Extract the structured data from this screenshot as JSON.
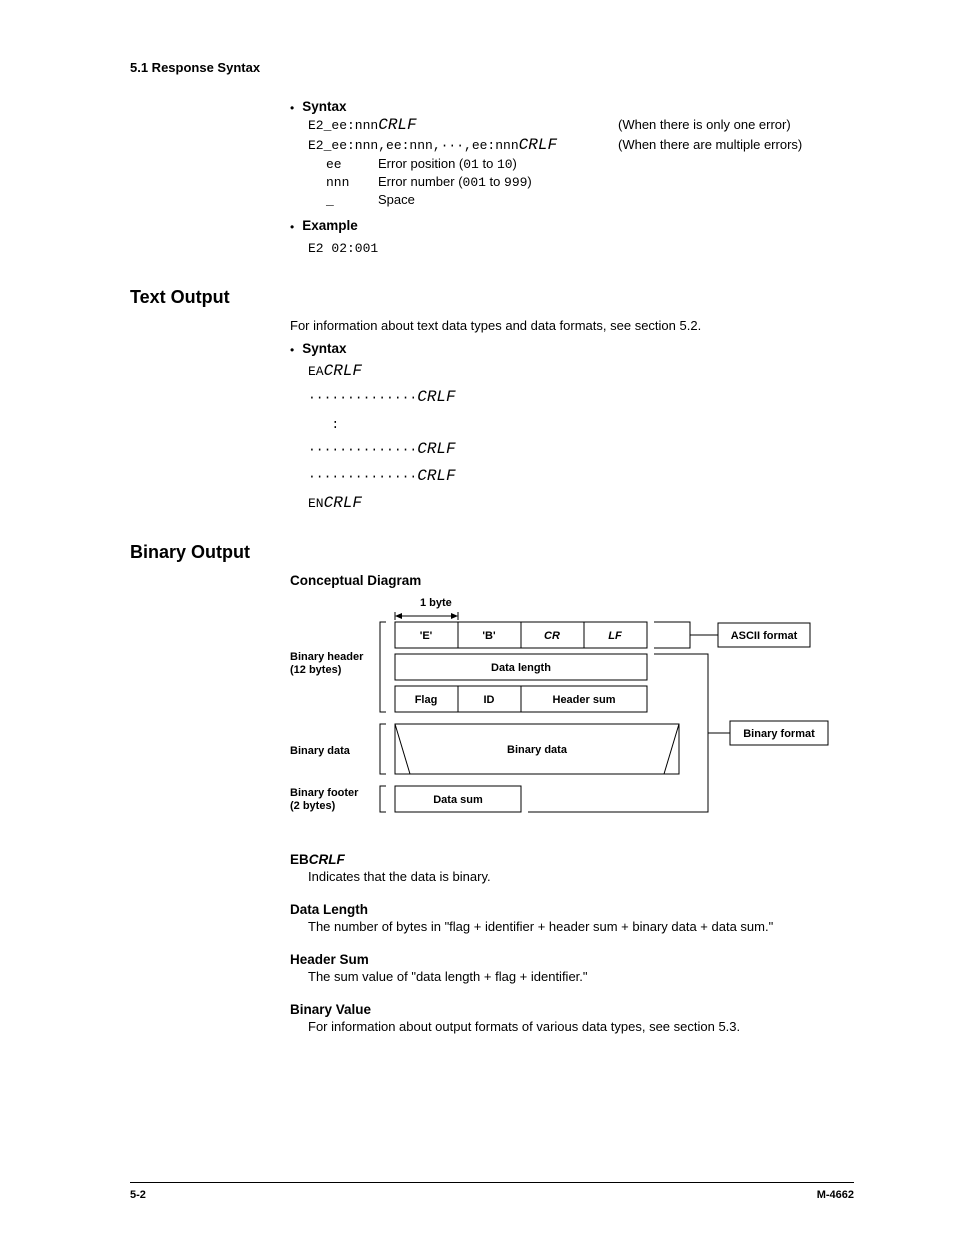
{
  "header": {
    "section_path": "5.1  Response Syntax"
  },
  "top_syntax": {
    "bullet_label": "Syntax",
    "line1_left_a": "E2_ee:nnn",
    "line1_left_crlf": "CRLF",
    "line1_note": "(When there is only one error)",
    "line2_left_a": "E2_ee:nnn,ee:nnn,···,ee:nnn",
    "line2_left_crlf": "CRLF",
    "line2_note": "(When there are multiple errors)",
    "defs": [
      {
        "key": "ee",
        "label": "Error position (",
        "mono": "01",
        "mid": " to ",
        "mono2": "10",
        "end": ")"
      },
      {
        "key": "nnn",
        "label": "Error number (",
        "mono": "001",
        "mid": " to ",
        "mono2": "999",
        "end": ")"
      },
      {
        "key": "_",
        "label": "Space",
        "mono": "",
        "mid": "",
        "mono2": "",
        "end": ""
      }
    ]
  },
  "example": {
    "bullet_label": "Example",
    "code": "E2 02:001"
  },
  "text_output": {
    "heading": "Text Output",
    "intro": "For information about text data types and data formats, see section 5.2.",
    "bullet_label": "Syntax",
    "lines": {
      "l1a": "EA",
      "l1b": "CRLF",
      "l2a": "··············",
      "l2b": "CRLF",
      "l3a": "   :",
      "l4a": "··············",
      "l4b": "CRLF",
      "l5a": "··············",
      "l5b": "CRLF",
      "l6a": "EN",
      "l6b": "CRLF"
    }
  },
  "binary_output": {
    "heading": "Binary Output",
    "concept_label": "Conceptual Diagram",
    "diagram": {
      "byte_label": "1 byte",
      "row1": {
        "c1": "'E'",
        "c2": "'B'",
        "c3": "CR",
        "c4": "LF"
      },
      "row2": "Data length",
      "row3": {
        "c1": "Flag",
        "c2": "ID",
        "c3": "Header sum"
      },
      "left1": "Binary header\n(12 bytes)",
      "left2": "Binary data",
      "left3": "Binary footer\n(2 bytes)",
      "center_data": "Binary data",
      "footer_box": "Data sum",
      "right1": "ASCII format",
      "right2": "Binary format"
    },
    "eb": {
      "head_a": "EB",
      "head_b": "CRLF",
      "desc": "Indicates that the data is binary."
    },
    "data_length": {
      "head": "Data Length",
      "desc": "The number of bytes in \"flag + identifier + header sum + binary data + data sum.\""
    },
    "header_sum": {
      "head": "Header Sum",
      "desc": "The sum value of \"data length + flag + identifier.\""
    },
    "binary_value": {
      "head": "Binary Value",
      "desc": "For information about output formats of various data types, see section 5.3."
    }
  },
  "footer": {
    "page": "5-2",
    "doc": "M-4662"
  }
}
